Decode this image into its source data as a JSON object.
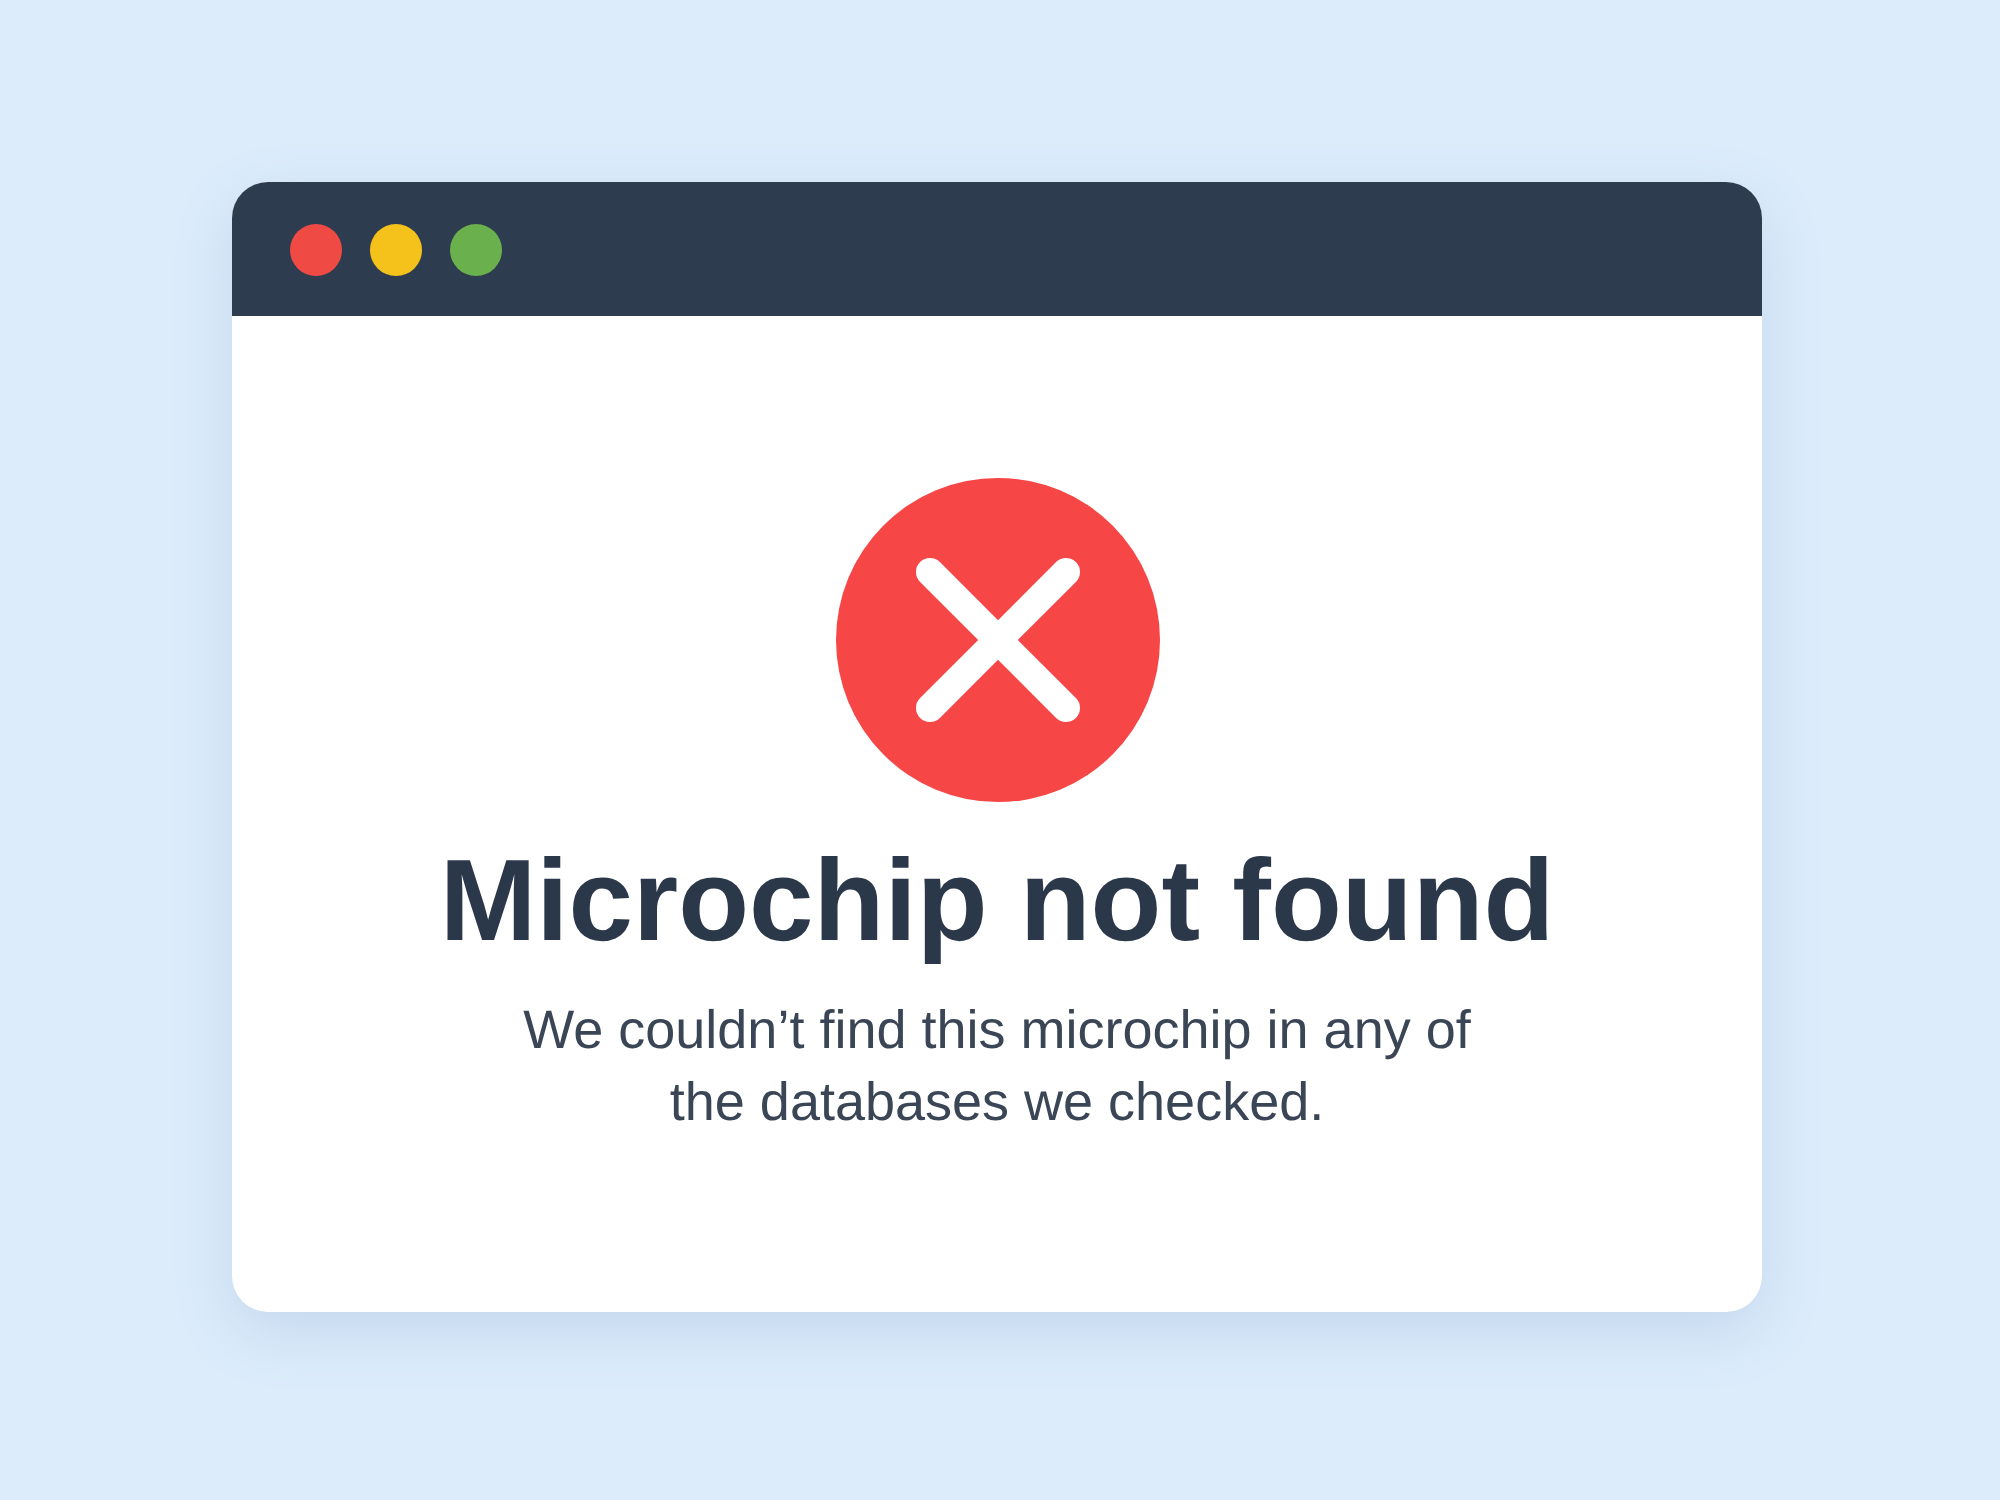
{
  "window": {
    "controls": [
      {
        "color": "#f04a45"
      },
      {
        "color": "#f5c21b"
      },
      {
        "color": "#6ab04c"
      }
    ]
  },
  "message": {
    "kind": "error",
    "title": "Microchip not found",
    "text": "We couldn’t find this microchip in any of the databases we checked."
  }
}
